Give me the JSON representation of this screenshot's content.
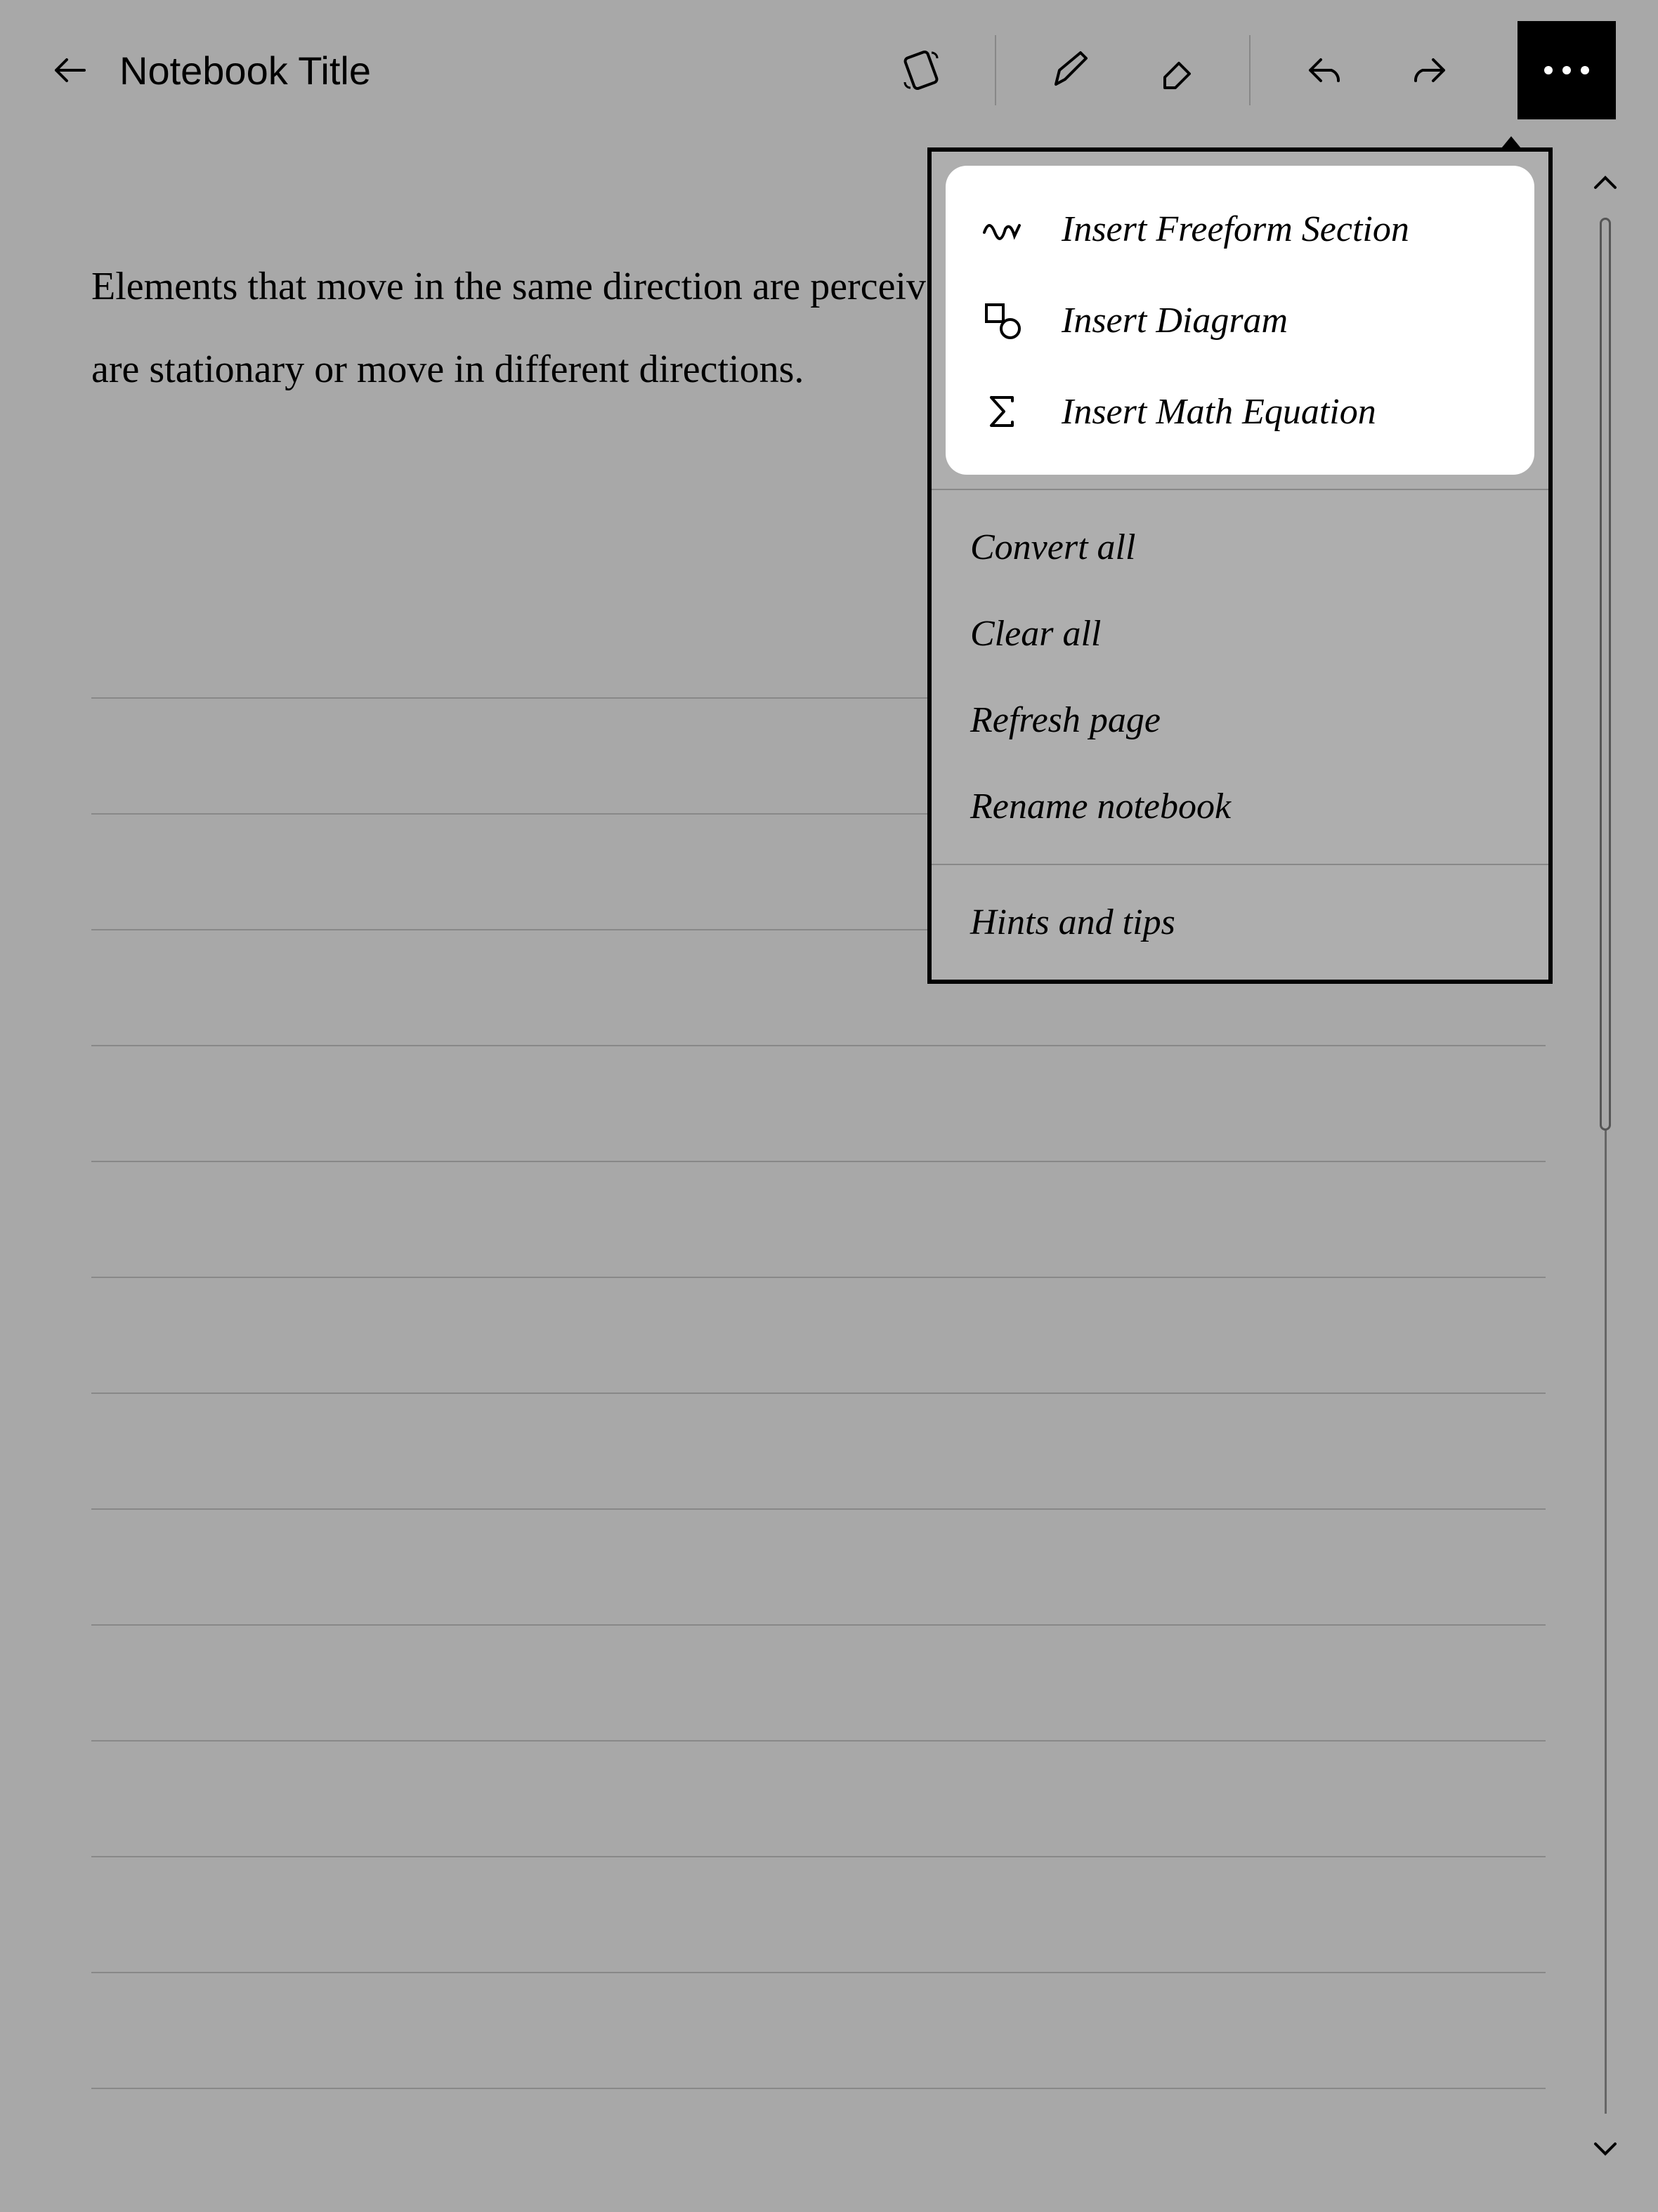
{
  "header": {
    "title": "Notebook Title"
  },
  "body": {
    "text": "Elements that move in the same direction are perceived as more related than elements that are stationary or move in different directions."
  },
  "menu": {
    "insert_freeform": "Insert Freeform Section",
    "insert_diagram": "Insert Diagram",
    "insert_math": "Insert Math Equation",
    "convert_all": "Convert all",
    "clear_all": "Clear all",
    "refresh_page": "Refresh page",
    "rename_notebook": "Rename notebook",
    "hints_tips": "Hints and tips"
  }
}
